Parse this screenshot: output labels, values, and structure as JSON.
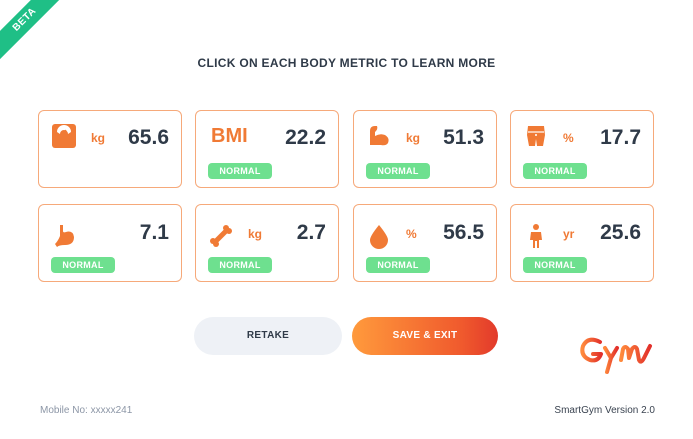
{
  "beta_label": "BETA",
  "headline": "CLICK ON EACH BODY METRIC TO LEARN MORE",
  "metrics": [
    {
      "icon": "scale-icon",
      "unit": "kg",
      "value": "65.6",
      "status": ""
    },
    {
      "icon": "bmi-text",
      "label": "BMI",
      "unit": "",
      "value": "22.2",
      "status": "NORMAL"
    },
    {
      "icon": "muscle-icon",
      "unit": "kg",
      "value": "51.3",
      "status": "NORMAL"
    },
    {
      "icon": "body-fat-icon",
      "unit": "%",
      "value": "17.7",
      "status": "NORMAL"
    },
    {
      "icon": "stomach-icon",
      "unit": "",
      "value": "7.1",
      "status": "NORMAL"
    },
    {
      "icon": "bone-icon",
      "unit": "kg",
      "value": "2.7",
      "status": "NORMAL"
    },
    {
      "icon": "water-drop-icon",
      "unit": "%",
      "value": "56.5",
      "status": "NORMAL"
    },
    {
      "icon": "person-icon",
      "unit": "yr",
      "value": "25.6",
      "status": "NORMAL"
    }
  ],
  "buttons": {
    "retake": "RETAKE",
    "save_exit": "SAVE & EXIT"
  },
  "footer": {
    "mobile": "Mobile No: xxxxx241",
    "version": "SmartGym Version 2.0"
  },
  "colors": {
    "accent": "#f07a35",
    "card_border": "#f6a97a",
    "status_normal": "#6ee08f",
    "beta_ribbon": "#1fbf86",
    "text_dark": "#2f3a48"
  }
}
